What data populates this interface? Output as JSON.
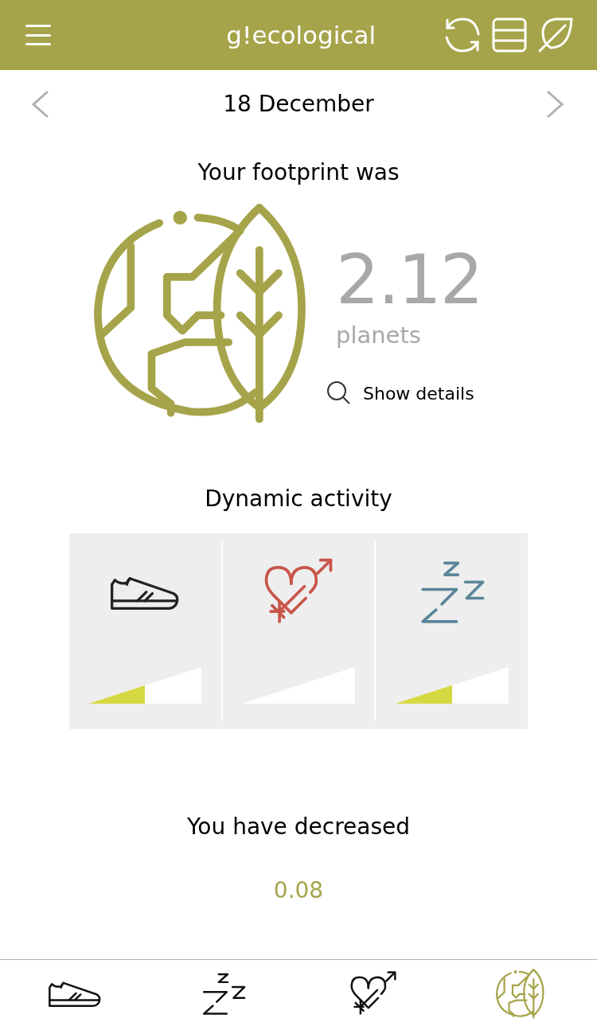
{
  "header": {
    "title": "g!ecological"
  },
  "date_nav": {
    "date": "18 December"
  },
  "footprint": {
    "heading": "Your footprint was",
    "value": "2.12",
    "unit": "planets",
    "details_link": "Show details"
  },
  "activity": {
    "heading": "Dynamic activity",
    "items": [
      {
        "kind": "steps",
        "level": 0.5
      },
      {
        "kind": "love"
      },
      {
        "kind": "sleep",
        "level": 0.5
      }
    ]
  },
  "change": {
    "heading": "You have decreased",
    "value": "0.08"
  },
  "tabs": [
    {
      "kind": "steps",
      "selected": false
    },
    {
      "kind": "sleep",
      "selected": false
    },
    {
      "kind": "love",
      "selected": false
    },
    {
      "kind": "eco",
      "selected": true
    }
  ]
}
